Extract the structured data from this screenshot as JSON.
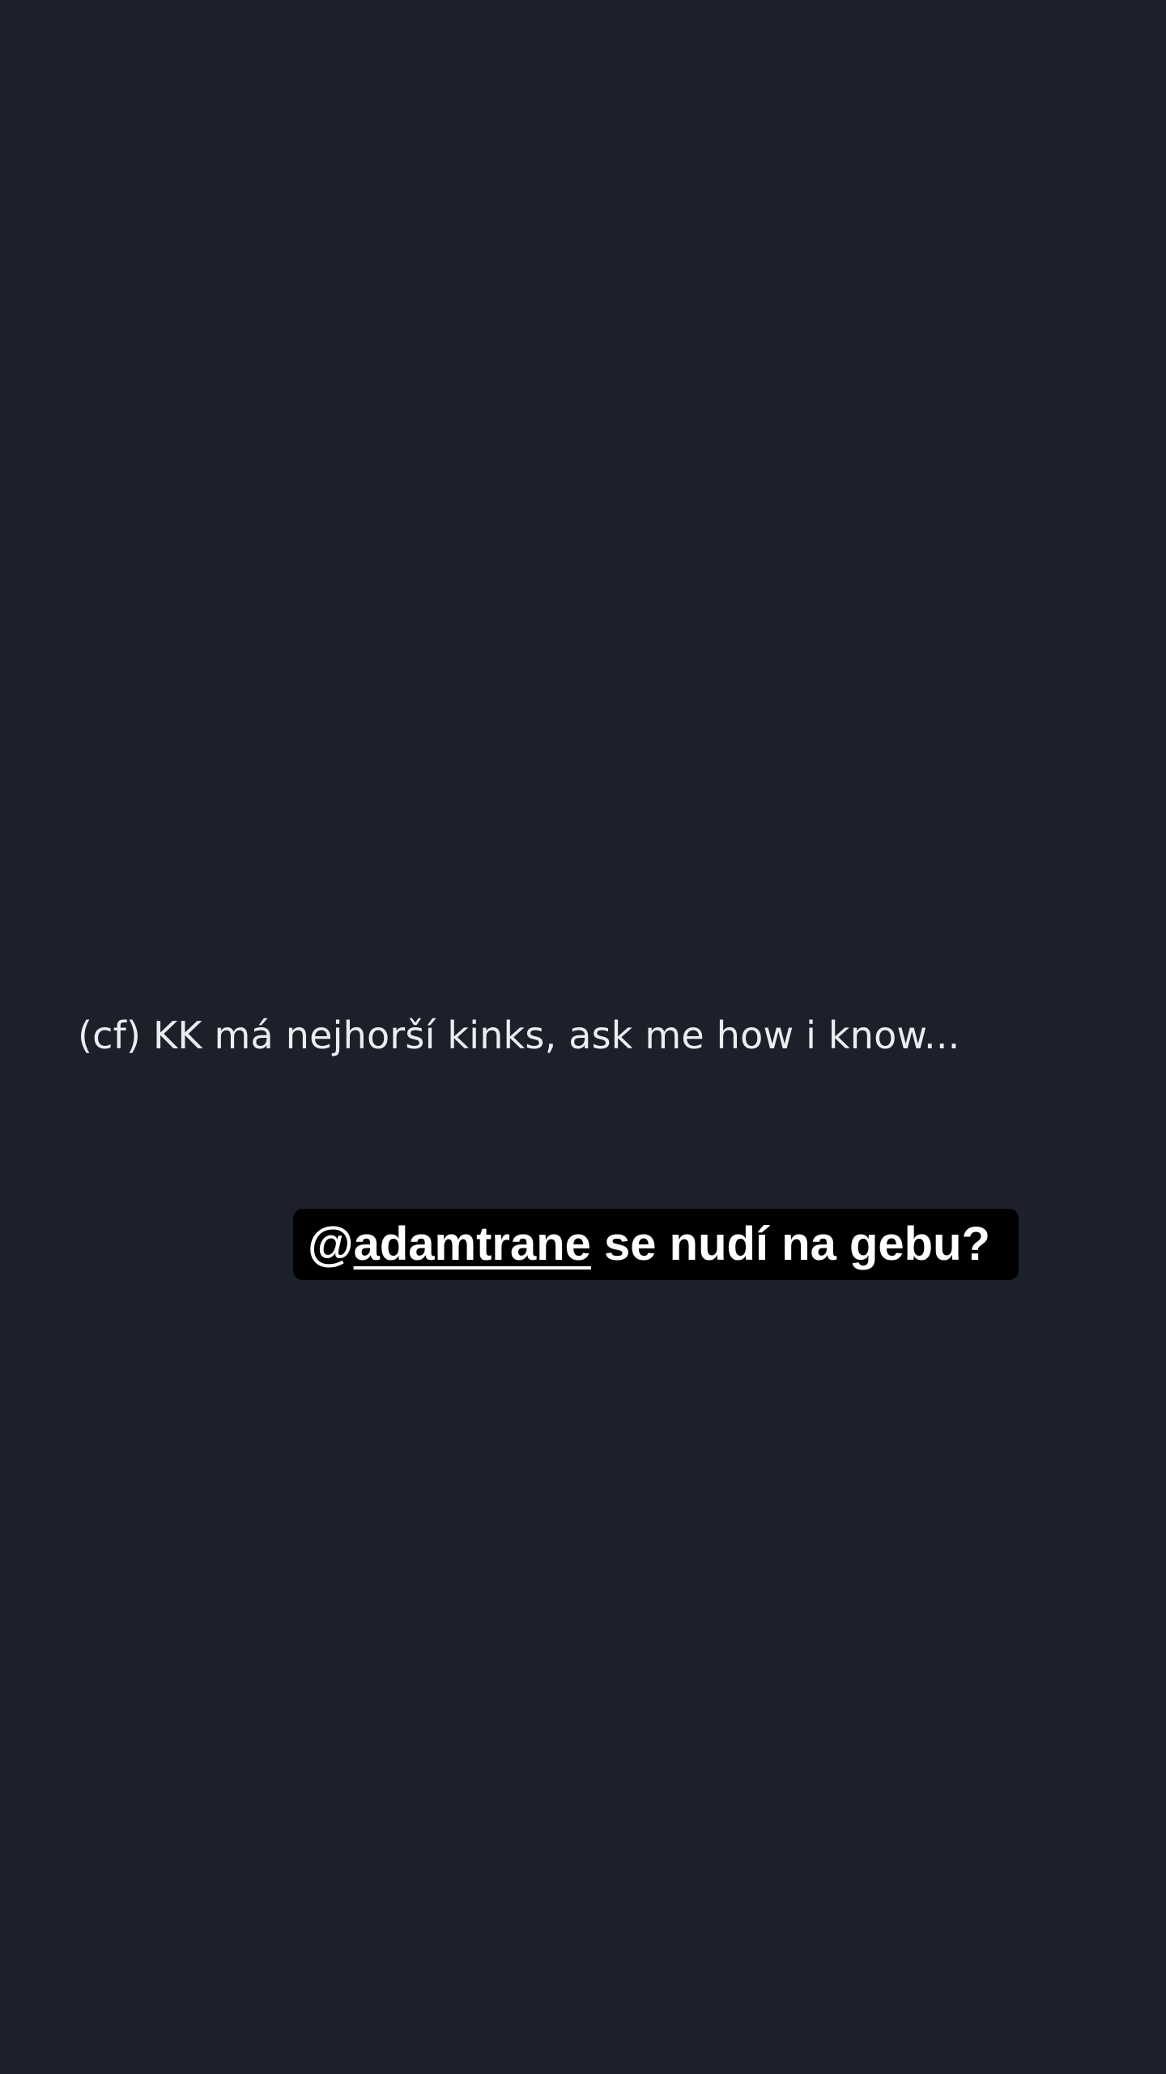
{
  "story": {
    "text_line": "(cf) KK má nejhorší kinks, ask me how i know...",
    "mention_sticker": {
      "at_sign": "@",
      "username": "adamtrane",
      "suffix": " se nudí na gebu?"
    }
  },
  "colors": {
    "background": "#1c202b",
    "text": "#ecedf0",
    "sticker_background": "#000000",
    "sticker_text": "#ffffff"
  }
}
